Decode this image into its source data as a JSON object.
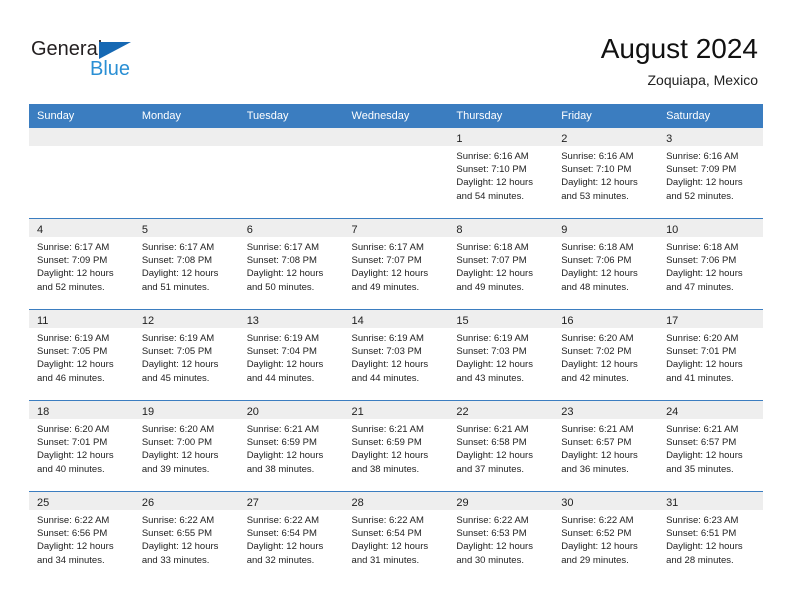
{
  "brand": {
    "name_part1": "General",
    "name_part2": "Blue",
    "triangle_icon": "triangle-icon",
    "color_dark": "#231f20",
    "color_blue": "#2a8fd4",
    "color_triangle": "#1668b3"
  },
  "header": {
    "title": "August 2024",
    "subtitle": "Zoquiapa, Mexico"
  },
  "theme": {
    "header_bg": "#3b7dc0",
    "header_text": "#ffffff",
    "daynum_band_bg": "#eeeeee",
    "divider": "#3b7dc0",
    "body_text": "#222222"
  },
  "weekday_headers": [
    "Sunday",
    "Monday",
    "Tuesday",
    "Wednesday",
    "Thursday",
    "Friday",
    "Saturday"
  ],
  "weeks": [
    [
      {
        "day": "",
        "sunrise": "",
        "sunset": "",
        "daylight_line1": "",
        "daylight_line2": ""
      },
      {
        "day": "",
        "sunrise": "",
        "sunset": "",
        "daylight_line1": "",
        "daylight_line2": ""
      },
      {
        "day": "",
        "sunrise": "",
        "sunset": "",
        "daylight_line1": "",
        "daylight_line2": ""
      },
      {
        "day": "",
        "sunrise": "",
        "sunset": "",
        "daylight_line1": "",
        "daylight_line2": ""
      },
      {
        "day": "1",
        "sunrise": "Sunrise: 6:16 AM",
        "sunset": "Sunset: 7:10 PM",
        "daylight_line1": "Daylight: 12 hours",
        "daylight_line2": "and 54 minutes."
      },
      {
        "day": "2",
        "sunrise": "Sunrise: 6:16 AM",
        "sunset": "Sunset: 7:10 PM",
        "daylight_line1": "Daylight: 12 hours",
        "daylight_line2": "and 53 minutes."
      },
      {
        "day": "3",
        "sunrise": "Sunrise: 6:16 AM",
        "sunset": "Sunset: 7:09 PM",
        "daylight_line1": "Daylight: 12 hours",
        "daylight_line2": "and 52 minutes."
      }
    ],
    [
      {
        "day": "4",
        "sunrise": "Sunrise: 6:17 AM",
        "sunset": "Sunset: 7:09 PM",
        "daylight_line1": "Daylight: 12 hours",
        "daylight_line2": "and 52 minutes."
      },
      {
        "day": "5",
        "sunrise": "Sunrise: 6:17 AM",
        "sunset": "Sunset: 7:08 PM",
        "daylight_line1": "Daylight: 12 hours",
        "daylight_line2": "and 51 minutes."
      },
      {
        "day": "6",
        "sunrise": "Sunrise: 6:17 AM",
        "sunset": "Sunset: 7:08 PM",
        "daylight_line1": "Daylight: 12 hours",
        "daylight_line2": "and 50 minutes."
      },
      {
        "day": "7",
        "sunrise": "Sunrise: 6:17 AM",
        "sunset": "Sunset: 7:07 PM",
        "daylight_line1": "Daylight: 12 hours",
        "daylight_line2": "and 49 minutes."
      },
      {
        "day": "8",
        "sunrise": "Sunrise: 6:18 AM",
        "sunset": "Sunset: 7:07 PM",
        "daylight_line1": "Daylight: 12 hours",
        "daylight_line2": "and 49 minutes."
      },
      {
        "day": "9",
        "sunrise": "Sunrise: 6:18 AM",
        "sunset": "Sunset: 7:06 PM",
        "daylight_line1": "Daylight: 12 hours",
        "daylight_line2": "and 48 minutes."
      },
      {
        "day": "10",
        "sunrise": "Sunrise: 6:18 AM",
        "sunset": "Sunset: 7:06 PM",
        "daylight_line1": "Daylight: 12 hours",
        "daylight_line2": "and 47 minutes."
      }
    ],
    [
      {
        "day": "11",
        "sunrise": "Sunrise: 6:19 AM",
        "sunset": "Sunset: 7:05 PM",
        "daylight_line1": "Daylight: 12 hours",
        "daylight_line2": "and 46 minutes."
      },
      {
        "day": "12",
        "sunrise": "Sunrise: 6:19 AM",
        "sunset": "Sunset: 7:05 PM",
        "daylight_line1": "Daylight: 12 hours",
        "daylight_line2": "and 45 minutes."
      },
      {
        "day": "13",
        "sunrise": "Sunrise: 6:19 AM",
        "sunset": "Sunset: 7:04 PM",
        "daylight_line1": "Daylight: 12 hours",
        "daylight_line2": "and 44 minutes."
      },
      {
        "day": "14",
        "sunrise": "Sunrise: 6:19 AM",
        "sunset": "Sunset: 7:03 PM",
        "daylight_line1": "Daylight: 12 hours",
        "daylight_line2": "and 44 minutes."
      },
      {
        "day": "15",
        "sunrise": "Sunrise: 6:19 AM",
        "sunset": "Sunset: 7:03 PM",
        "daylight_line1": "Daylight: 12 hours",
        "daylight_line2": "and 43 minutes."
      },
      {
        "day": "16",
        "sunrise": "Sunrise: 6:20 AM",
        "sunset": "Sunset: 7:02 PM",
        "daylight_line1": "Daylight: 12 hours",
        "daylight_line2": "and 42 minutes."
      },
      {
        "day": "17",
        "sunrise": "Sunrise: 6:20 AM",
        "sunset": "Sunset: 7:01 PM",
        "daylight_line1": "Daylight: 12 hours",
        "daylight_line2": "and 41 minutes."
      }
    ],
    [
      {
        "day": "18",
        "sunrise": "Sunrise: 6:20 AM",
        "sunset": "Sunset: 7:01 PM",
        "daylight_line1": "Daylight: 12 hours",
        "daylight_line2": "and 40 minutes."
      },
      {
        "day": "19",
        "sunrise": "Sunrise: 6:20 AM",
        "sunset": "Sunset: 7:00 PM",
        "daylight_line1": "Daylight: 12 hours",
        "daylight_line2": "and 39 minutes."
      },
      {
        "day": "20",
        "sunrise": "Sunrise: 6:21 AM",
        "sunset": "Sunset: 6:59 PM",
        "daylight_line1": "Daylight: 12 hours",
        "daylight_line2": "and 38 minutes."
      },
      {
        "day": "21",
        "sunrise": "Sunrise: 6:21 AM",
        "sunset": "Sunset: 6:59 PM",
        "daylight_line1": "Daylight: 12 hours",
        "daylight_line2": "and 38 minutes."
      },
      {
        "day": "22",
        "sunrise": "Sunrise: 6:21 AM",
        "sunset": "Sunset: 6:58 PM",
        "daylight_line1": "Daylight: 12 hours",
        "daylight_line2": "and 37 minutes."
      },
      {
        "day": "23",
        "sunrise": "Sunrise: 6:21 AM",
        "sunset": "Sunset: 6:57 PM",
        "daylight_line1": "Daylight: 12 hours",
        "daylight_line2": "and 36 minutes."
      },
      {
        "day": "24",
        "sunrise": "Sunrise: 6:21 AM",
        "sunset": "Sunset: 6:57 PM",
        "daylight_line1": "Daylight: 12 hours",
        "daylight_line2": "and 35 minutes."
      }
    ],
    [
      {
        "day": "25",
        "sunrise": "Sunrise: 6:22 AM",
        "sunset": "Sunset: 6:56 PM",
        "daylight_line1": "Daylight: 12 hours",
        "daylight_line2": "and 34 minutes."
      },
      {
        "day": "26",
        "sunrise": "Sunrise: 6:22 AM",
        "sunset": "Sunset: 6:55 PM",
        "daylight_line1": "Daylight: 12 hours",
        "daylight_line2": "and 33 minutes."
      },
      {
        "day": "27",
        "sunrise": "Sunrise: 6:22 AM",
        "sunset": "Sunset: 6:54 PM",
        "daylight_line1": "Daylight: 12 hours",
        "daylight_line2": "and 32 minutes."
      },
      {
        "day": "28",
        "sunrise": "Sunrise: 6:22 AM",
        "sunset": "Sunset: 6:54 PM",
        "daylight_line1": "Daylight: 12 hours",
        "daylight_line2": "and 31 minutes."
      },
      {
        "day": "29",
        "sunrise": "Sunrise: 6:22 AM",
        "sunset": "Sunset: 6:53 PM",
        "daylight_line1": "Daylight: 12 hours",
        "daylight_line2": "and 30 minutes."
      },
      {
        "day": "30",
        "sunrise": "Sunrise: 6:22 AM",
        "sunset": "Sunset: 6:52 PM",
        "daylight_line1": "Daylight: 12 hours",
        "daylight_line2": "and 29 minutes."
      },
      {
        "day": "31",
        "sunrise": "Sunrise: 6:23 AM",
        "sunset": "Sunset: 6:51 PM",
        "daylight_line1": "Daylight: 12 hours",
        "daylight_line2": "and 28 minutes."
      }
    ]
  ]
}
